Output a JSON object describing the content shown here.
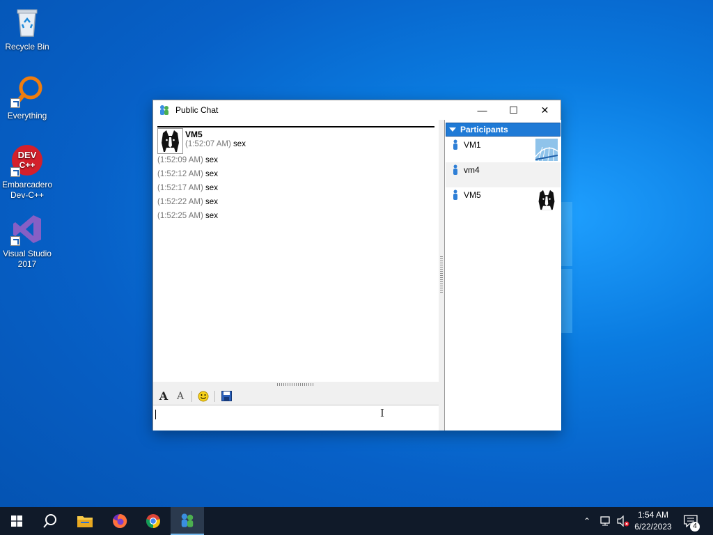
{
  "desktop": {
    "icons": [
      {
        "label": "Recycle Bin"
      },
      {
        "label": "Everything"
      },
      {
        "label": "Embarcadero Dev-C++"
      },
      {
        "label": "Visual Studio 2017"
      }
    ]
  },
  "window": {
    "title": "Public Chat",
    "controls": {
      "minimize": "—",
      "maximize": "☐",
      "close": "✕"
    }
  },
  "chat": {
    "first_message": {
      "sender": "VM5",
      "time": "(1:52:07 AM)",
      "text": "sex"
    },
    "messages": [
      {
        "time": "(1:52:09 AM)",
        "text": "sex"
      },
      {
        "time": "(1:52:12 AM)",
        "text": "sex"
      },
      {
        "time": "(1:52:17 AM)",
        "text": "sex"
      },
      {
        "time": "(1:52:22 AM)",
        "text": "sex"
      },
      {
        "time": "(1:52:25 AM)",
        "text": "sex"
      }
    ]
  },
  "toolbar": {
    "font_icon": "font-icon",
    "font_color_icon": "font-color-icon",
    "emoticon_icon": "smiley-icon",
    "save_icon": "save-icon"
  },
  "input": {
    "value": ""
  },
  "participants": {
    "header": "Participants",
    "items": [
      {
        "name": "VM1",
        "thumb": "bridge-photo"
      },
      {
        "name": "vm4",
        "thumb": ""
      },
      {
        "name": "VM5",
        "thumb": "dog-photo"
      }
    ]
  },
  "taskbar": {
    "apps": [
      "start-icon",
      "search-icon",
      "file-explorer-icon",
      "firefox-icon",
      "chrome-icon",
      "chat-app-icon"
    ],
    "time": "1:54 AM",
    "date": "6/22/2023",
    "notification_count": "4"
  },
  "colors": {
    "participants_header": "#1f7ad6",
    "taskbar": "#101a29",
    "desktop": "#0a7be0"
  }
}
